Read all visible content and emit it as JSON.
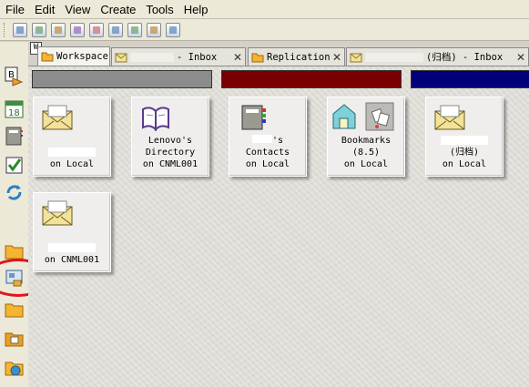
{
  "menu": {
    "items": [
      "File",
      "Edit",
      "View",
      "Create",
      "Tools",
      "Help"
    ]
  },
  "toolbar": {
    "icons": [
      "new-icon",
      "open-icon",
      "print-icon",
      "forward-icon",
      "reply-icon",
      "copy-icon",
      "paste-icon",
      "attach-icon",
      "help-icon"
    ]
  },
  "sidebar": {
    "icons": [
      "bookmark-icon",
      "calendar-icon",
      "address-book-icon",
      "todo-icon",
      "replication-icon",
      "folder-icon",
      "database-icon",
      "folder-icon",
      "folder-icon",
      "favorites-icon"
    ]
  },
  "tabs": {
    "window_marker": "W",
    "items": [
      {
        "label": "Workspace",
        "close": ""
      },
      {
        "label": "- Inbox",
        "close": "✕"
      },
      {
        "label": "Replication",
        "close": "✕"
      },
      {
        "label": "(归档) - Inbox",
        "close": "✕"
      }
    ]
  },
  "workspace": {
    "pages": [
      {
        "color": "#8c8c8c"
      },
      {
        "color": "#7a0000"
      },
      {
        "color": "#00007a"
      }
    ],
    "tiles": [
      {
        "icon": "mail-icon",
        "lines": [
          "on Local"
        ]
      },
      {
        "icon": "book-icon",
        "lines": [
          "Lenovo's",
          "Directory",
          "on CNML001"
        ]
      },
      {
        "icon": "address-book-icon",
        "lines": [
          "'s",
          "Contacts",
          "on Local"
        ]
      },
      {
        "icon": "bookmarks-icon",
        "lines": [
          "Bookmarks",
          "(8.5)",
          "on Local"
        ]
      },
      {
        "icon": "mail-icon",
        "lines": [
          "(归档)",
          "on Local"
        ]
      },
      {
        "icon": "mail-icon",
        "lines": [
          "on CNML001"
        ]
      }
    ]
  }
}
